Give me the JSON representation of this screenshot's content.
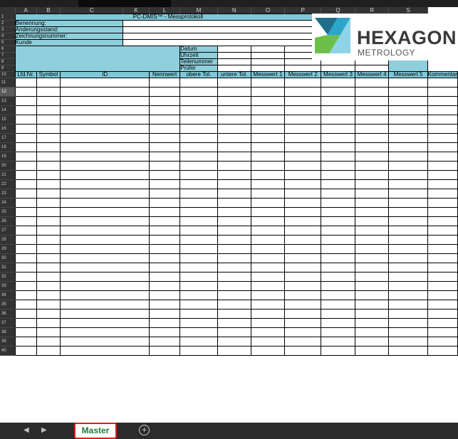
{
  "columns": [
    "A",
    "B",
    "C",
    "K",
    "L",
    "M",
    "N",
    "O",
    "P",
    "Q",
    "R",
    "S"
  ],
  "title": "PC-DMIS™ - Messprotokoll",
  "fields": [
    "Benennung:",
    "Änderungsstand:",
    "Zeichnungsnummer:",
    "Kunde"
  ],
  "info_labels": [
    "Datum",
    "Uhrzeit",
    "Teilenummer",
    "Prüfer"
  ],
  "headers": [
    "Lfd.Nr.",
    "Symbol",
    "ID",
    "Nennwert",
    "obere Tol.",
    "untere Tol.",
    "Messwert 1",
    "Messwert 2",
    "Messwert 3",
    "Messwert 4",
    "Messwert 5",
    "Kommentar"
  ],
  "row_numbers": [
    "1",
    "2",
    "3",
    "4",
    "5",
    "6",
    "7",
    "8",
    "9",
    "10",
    "11",
    "12",
    "13",
    "14",
    "15",
    "16",
    "17",
    "18",
    "19",
    "20",
    "21",
    "22",
    "23",
    "24",
    "25",
    "26",
    "27",
    "28",
    "29",
    "30",
    "31",
    "32",
    "33",
    "34",
    "35",
    "36",
    "37",
    "38",
    "39",
    "40"
  ],
  "logo": {
    "word": "HEXAGON",
    "sub": "METROLOGY"
  },
  "sheet_tabs": [
    {
      "label": "Master",
      "active": true
    }
  ],
  "add_sheet_icon": "plus-circle-icon",
  "nav_icons": [
    "scroll-left-icon",
    "scroll-right-icon"
  ],
  "colors": {
    "teal": "#7ec8d8",
    "tab_text": "#1e7b3a",
    "highlight_border": "#e11d1d"
  }
}
